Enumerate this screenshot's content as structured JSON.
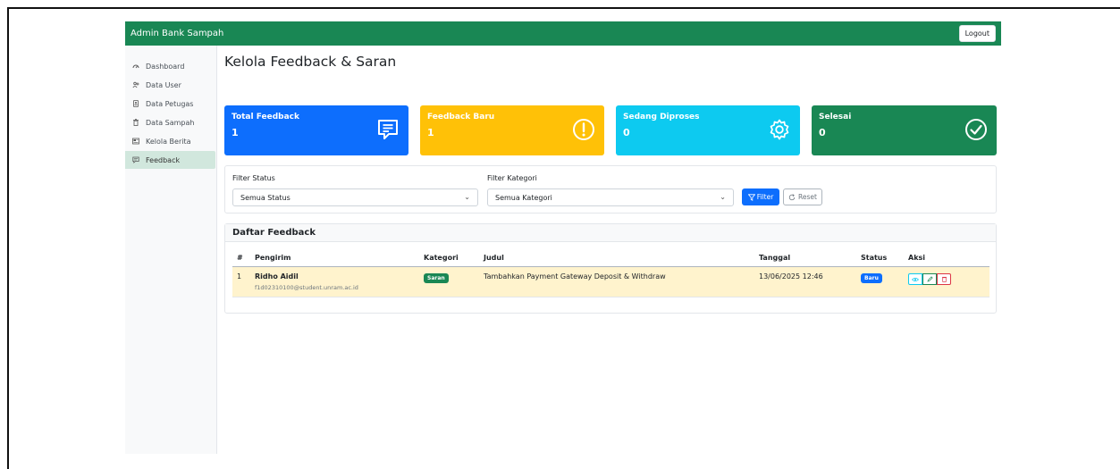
{
  "topbar": {
    "brand": "Admin Bank Sampah",
    "logout_label": "Logout"
  },
  "sidebar": {
    "items": [
      {
        "label": "Dashboard",
        "icon": "dashboard-icon"
      },
      {
        "label": "Data User",
        "icon": "users-icon"
      },
      {
        "label": "Data Petugas",
        "icon": "id-card-icon"
      },
      {
        "label": "Data Sampah",
        "icon": "trash-icon"
      },
      {
        "label": "Kelola Berita",
        "icon": "newspaper-icon"
      },
      {
        "label": "Feedback",
        "icon": "chat-icon",
        "active": true
      }
    ]
  },
  "page": {
    "title": "Kelola Feedback & Saran"
  },
  "stats": [
    {
      "label": "Total Feedback",
      "value": "1",
      "color": "#0d6efd",
      "icon": "message-icon"
    },
    {
      "label": "Feedback Baru",
      "value": "1",
      "color": "#ffc107",
      "icon": "alert-icon"
    },
    {
      "label": "Sedang Diproses",
      "value": "0",
      "color": "#0dcaf0",
      "icon": "gear-icon"
    },
    {
      "label": "Selesai",
      "value": "0",
      "color": "#198754",
      "icon": "check-circle-icon"
    }
  ],
  "filters": {
    "status_label": "Filter Status",
    "status_value": "Semua Status",
    "category_label": "Filter Kategori",
    "category_value": "Semua Kategori",
    "filter_button": "Filter",
    "reset_button": "Reset"
  },
  "list": {
    "title": "Daftar Feedback",
    "columns": [
      "#",
      "Pengirim",
      "Kategori",
      "Judul",
      "Tanggal",
      "Status",
      "Aksi"
    ],
    "rows": [
      {
        "no": "1",
        "name": "Ridho Aidil",
        "email": "f1d02310100@student.unram.ac.id",
        "category": "Saran",
        "title": "Tambahkan Payment Gateway Deposit & Withdraw",
        "date": "13/06/2025 12:46",
        "status": "Baru"
      }
    ]
  },
  "colors": {
    "primary": "#0d6efd",
    "success": "#198754",
    "warning": "#ffc107",
    "info": "#0dcaf0",
    "danger": "#dc3545"
  }
}
